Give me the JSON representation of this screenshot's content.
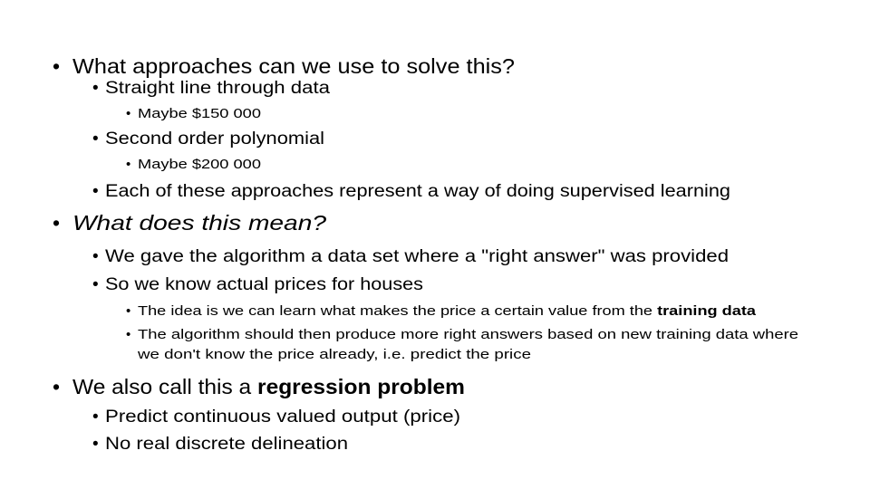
{
  "slide": {
    "bullet_char": "•",
    "items": [
      {
        "level": 1,
        "text": "What approaches can we use to solve this?"
      },
      {
        "level": 2,
        "text": "Straight line through data"
      },
      {
        "level": 3,
        "text": "Maybe $150 000"
      },
      {
        "level": 2,
        "text": "Second order polynomial"
      },
      {
        "level": 3,
        "text": "Maybe $200 000"
      },
      {
        "level": 2,
        "text": "Each of these approaches represent a way of doing supervised learning"
      },
      {
        "level": 1,
        "text": "What does this mean?",
        "italic": true
      },
      {
        "level": 2,
        "text": "We gave the algorithm a data set where a \"right answer\" was provided"
      },
      {
        "level": 2,
        "text": "So we know actual prices for houses"
      },
      {
        "level": 3,
        "text_before": "The idea is we can learn what makes the price a certain value from the ",
        "bold": "training data"
      },
      {
        "level": 3,
        "text": "The algorithm should then produce more right answers based on new training data where",
        "continuation": "we don't know the price already, i.e. predict the price"
      },
      {
        "level": 1,
        "text_before": "We also call this a ",
        "bold": "regression problem"
      },
      {
        "level": 2,
        "text": "Predict continuous valued output (price)"
      },
      {
        "level": 2,
        "text": "No real discrete delineation"
      }
    ]
  }
}
